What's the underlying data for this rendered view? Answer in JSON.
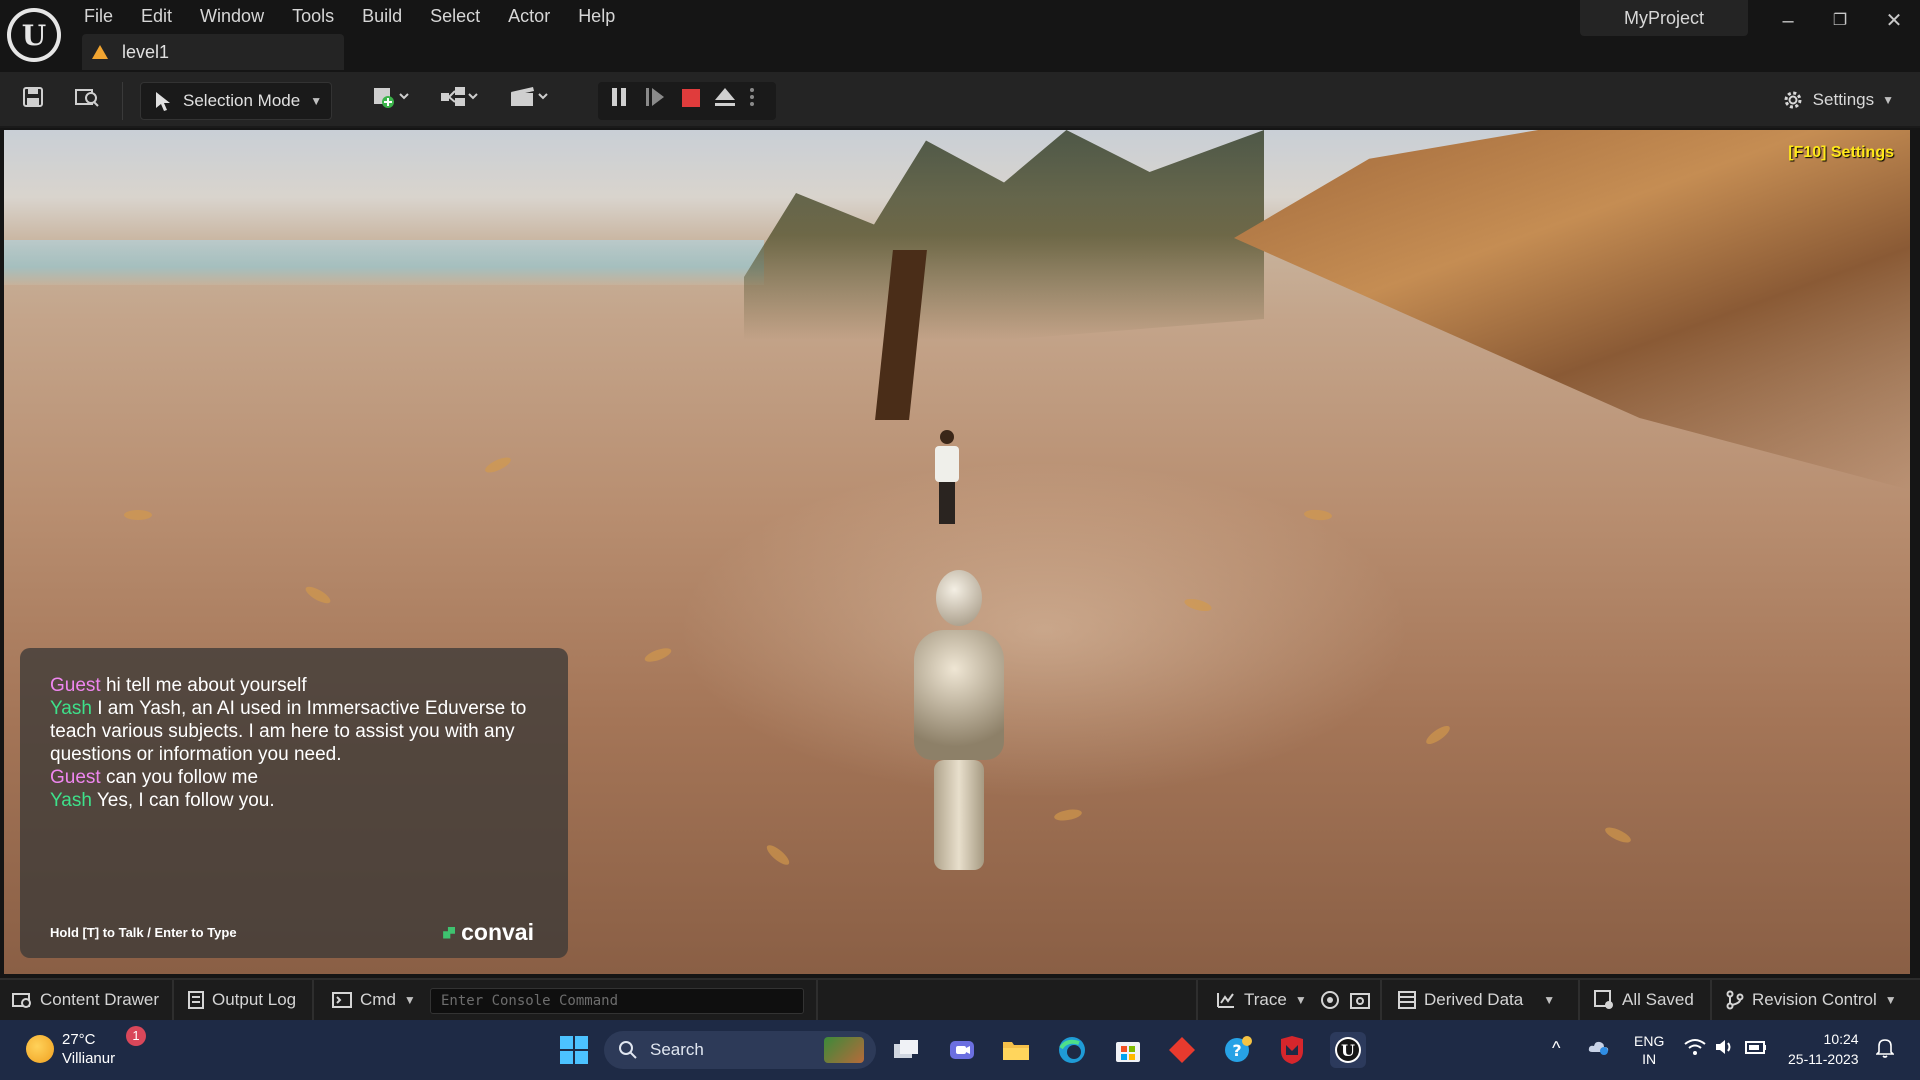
{
  "menubar": {
    "items": [
      "File",
      "Edit",
      "Window",
      "Tools",
      "Build",
      "Select",
      "Actor",
      "Help"
    ],
    "level_tab": "level1",
    "project_name": "MyProject",
    "window_controls": [
      "minimize-icon",
      "restore-icon",
      "close-icon"
    ]
  },
  "toolbar": {
    "selection_mode": "Selection Mode",
    "settings": "Settings",
    "icons": [
      "save-icon",
      "browse-icon",
      "add-actor-icon",
      "blueprint-icon",
      "cinematics-icon",
      "pause-icon",
      "resume-icon",
      "stop-icon",
      "eject-icon",
      "more-icon",
      "gear-icon"
    ]
  },
  "viewport": {
    "overlay_settings": "[F10] Settings",
    "chat": {
      "lines": [
        {
          "speaker": "Guest",
          "text": "hi tell me about yourself"
        },
        {
          "speaker": "Yash",
          "text": " I am Yash, an AI used in Immersactive Eduverse to teach various subjects.  I am here to assist you with any questions or information you need."
        },
        {
          "speaker": "Guest",
          "text": "can you follow me"
        },
        {
          "speaker": "Yash",
          "text": " Yes, I can follow you."
        }
      ],
      "hint": "Hold [T] to Talk / Enter to Type",
      "brand": "convai"
    }
  },
  "statusbar": {
    "content_drawer": "Content Drawer",
    "output_log": "Output Log",
    "cmd": "Cmd",
    "console_placeholder": "Enter Console Command",
    "trace": "Trace",
    "derived_data": "Derived Data",
    "all_saved": "All Saved",
    "revision_control": "Revision Control"
  },
  "taskbar": {
    "weather": {
      "temp": "27°C",
      "location": "Villianur",
      "badge": "1"
    },
    "search_label": "Search",
    "language": {
      "line1": "ENG",
      "line2": "IN"
    },
    "clock": {
      "time": "10:24",
      "date": "25-11-2023"
    }
  },
  "colors": {
    "guest": "#ee86ef",
    "yash": "#3ee08a",
    "f10": "#ffe81a",
    "stop": "#e03c3c"
  }
}
